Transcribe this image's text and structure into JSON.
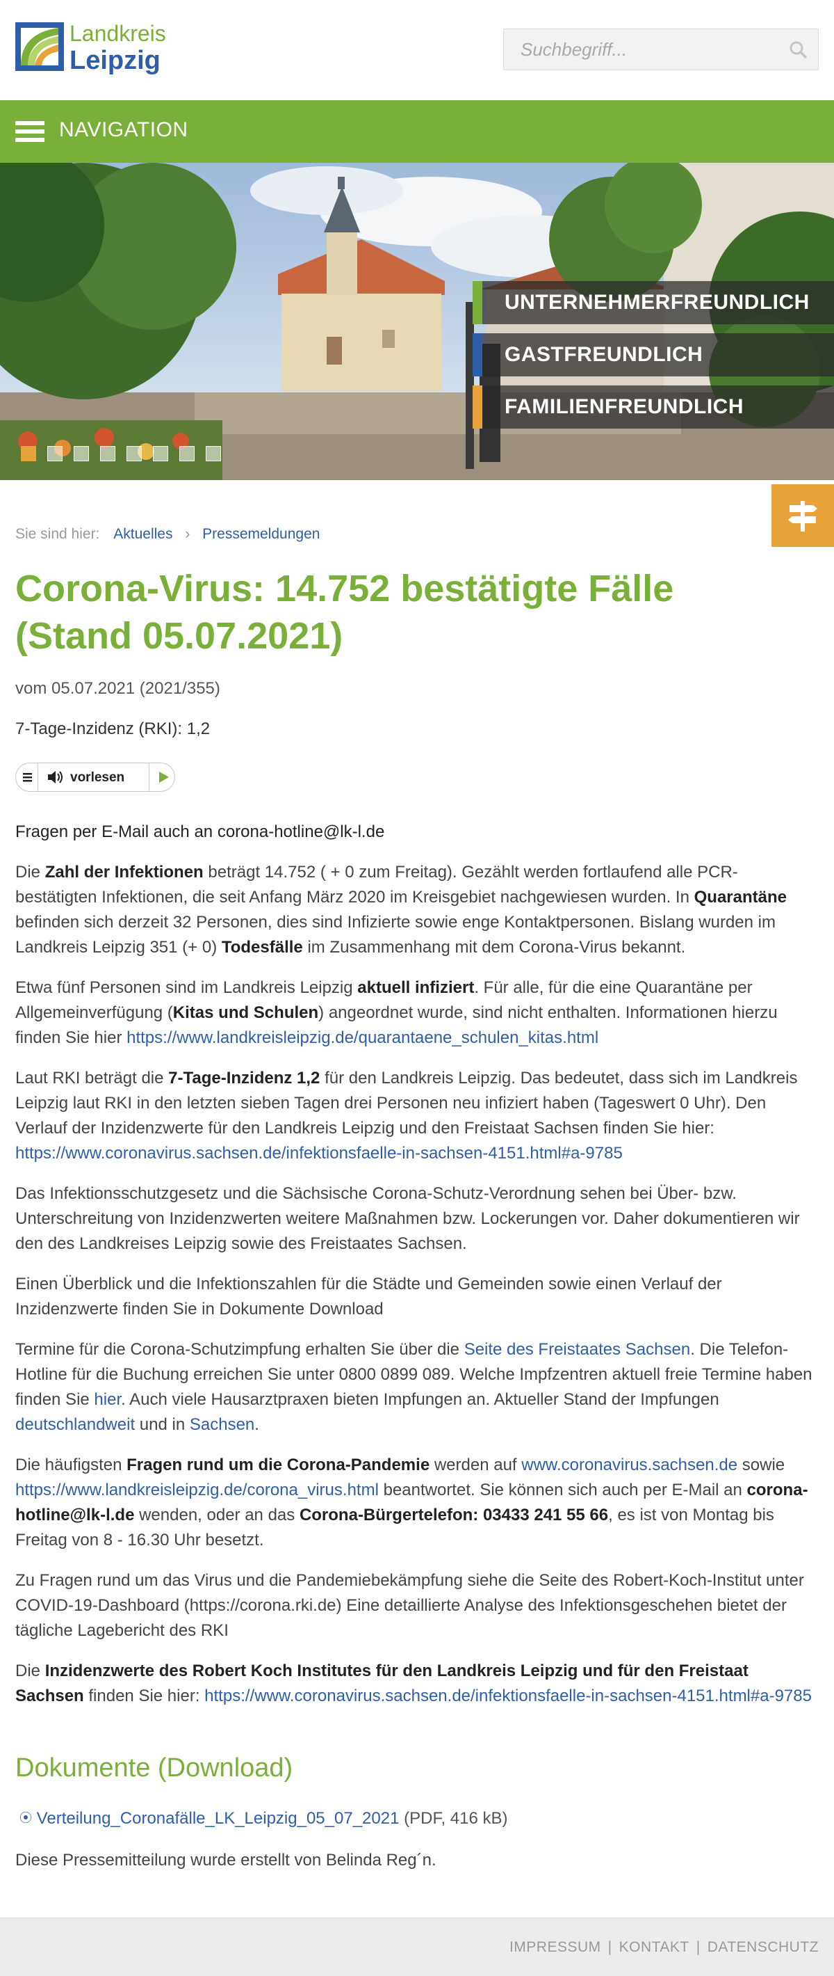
{
  "header": {
    "logo_line1": "Landkreis",
    "logo_line2": "Leipzig",
    "search_placeholder": "Suchbegriff..."
  },
  "nav": {
    "label": "NAVIGATION"
  },
  "hero": {
    "slogans": [
      {
        "text": "UNTERNEHMERFREUNDLICH",
        "color": "#7ab03a"
      },
      {
        "text": "GASTFREUNDLICH",
        "color": "#2f5ea8"
      },
      {
        "text": "FAMILIENFREUNDLICH",
        "color": "#e8a23a"
      }
    ],
    "slide_count": 8,
    "active_slide": 1
  },
  "breadcrumb": {
    "prefix": "Sie sind hier:",
    "items": [
      "Aktuelles",
      "Pressemeldungen"
    ]
  },
  "article": {
    "title": "Corona-Virus: 14.752 bestätigte Fälle (Stand 05.07.2021)",
    "meta": "vom 05.07.2021 (2021/355)",
    "incidence": "7-Tage-Inzidenz (RKI): 1,2",
    "reader_label": "vorlesen",
    "p0": "Fragen per E-Mail auch an corona-hotline@lk-l.de",
    "p1": {
      "a": "Die ",
      "b": "Zahl der Infektionen",
      "c": " beträgt 14.752 ( + 0 zum Freitag). Gezählt werden fortlaufend alle PCR-bestätigten Infektionen, die seit Anfang März 2020 im Kreisgebiet nachgewiesen wurden. In ",
      "d": "Quarantäne",
      "e": " befinden sich derzeit 32 Personen, dies sind Infizierte sowie enge Kontaktpersonen. Bislang wurden im Landkreis Leipzig 351 (+ 0) ",
      "f": "Todesfälle",
      "g": " im Zusammenhang mit dem Corona-Virus bekannt."
    },
    "p2": {
      "a": "Etwa fünf Personen sind im Landkreis Leipzig ",
      "b": "aktuell infiziert",
      "c": ". Für alle, für die eine Quarantäne per Allgemeinverfügung (",
      "d": "Kitas und Schulen",
      "e": ") angeordnet wurde, sind nicht enthalten. Informationen hierzu finden Sie hier ",
      "link": "https://www.landkreisleipzig.de/quarantaene_schulen_kitas.html"
    },
    "p3": {
      "a": "Laut RKI beträgt die ",
      "b": "7-Tage-Inzidenz 1,2",
      "c": "  für den Landkreis Leipzig. Das bedeutet, dass sich im Landkreis Leipzig laut RKI in den letzten sieben Tagen drei Personen neu infiziert haben (Tageswert 0 Uhr). Den Verlauf der Inzidenzwerte für den Landkreis Leipzig und den Freistaat Sachsen finden Sie hier: ",
      "link": "https://www.coronavirus.sachsen.de/infektionsfaelle-in-sachsen-4151.html#a-9785"
    },
    "p4": "Das Infektionsschutzgesetz und die Sächsische Corona-Schutz-Verordnung sehen bei Über- bzw. Unterschreitung von Inzidenzwerten weitere Maßnahmen bzw. Lockerungen vor. Daher dokumentieren wir den  des Landkreises Leipzig sowie des Freistaates Sachsen.",
    "p5": "Einen Überblick und die Infektionszahlen für die Städte und Gemeinden sowie einen Verlauf der Inzidenzwerte finden Sie in Dokumente Download",
    "p6": {
      "a": "Termine für die Corona-Schutzimpfung erhalten Sie über die ",
      "link1": "Seite des Freistaates Sachsen",
      "b": ". Die Telefon-Hotline für die Buchung erreichen Sie unter 0800 0899 089. Welche Impfzentren aktuell freie Termine haben finden Sie ",
      "link2": "hier",
      "c": ".  Auch viele Hausarztpraxen bieten Impfungen an. Aktueller Stand der Impfungen ",
      "link3": "deutschlandweit",
      "d": " und in ",
      "link4": "Sachsen",
      "e": "."
    },
    "p7": {
      "a": "Die häufigsten ",
      "b": "Fragen rund um die Corona-Pandemie",
      "c": " werden auf ",
      "link1": "www.coronavirus.sachsen.de",
      "d": " sowie ",
      "link2": "https://www.landkreisleipzig.de/corona_virus.html",
      "e": " beantwortet. Sie können sich auch per E-Mail an ",
      "f": "corona-hotline@lk-l.de",
      "g": " wenden, oder an das ",
      "h": "Corona-Bürgertelefon: 03433 241 55 66",
      "i": ", es ist von Montag bis Freitag von 8 - 16.30 Uhr besetzt."
    },
    "p8": "Zu Fragen rund um das Virus und die Pandemiebekämpfung siehe die Seite des Robert-Koch-Institut unter COVID-19-Dashboard (https://corona.rki.de)  Eine detaillierte Analyse des Infektionsgeschehen bietet der tägliche Lagebericht des RKI",
    "p9": {
      "a": "Die ",
      "b": "Inzidenzwerte des Robert Koch Institutes für den Landkreis Leipzig und für den Freistaat Sachsen",
      "c": " finden Sie hier: ",
      "link": "https://www.coronavirus.sachsen.de/infektionsfaelle-in-sachsen-4151.html#a-9785"
    },
    "docs_heading": "Dokumente (Download)",
    "doc": {
      "link": "Verteilung_Coronafälle_LK_Leipzig_05_07_2021",
      "info": " (PDF, 416 kB)"
    },
    "author": "Diese Pressemitteilung wurde erstellt von Belinda Reg´n."
  },
  "footer": {
    "links": [
      "IMPRESSUM",
      "KONTAKT",
      "DATENSCHUTZ"
    ]
  }
}
